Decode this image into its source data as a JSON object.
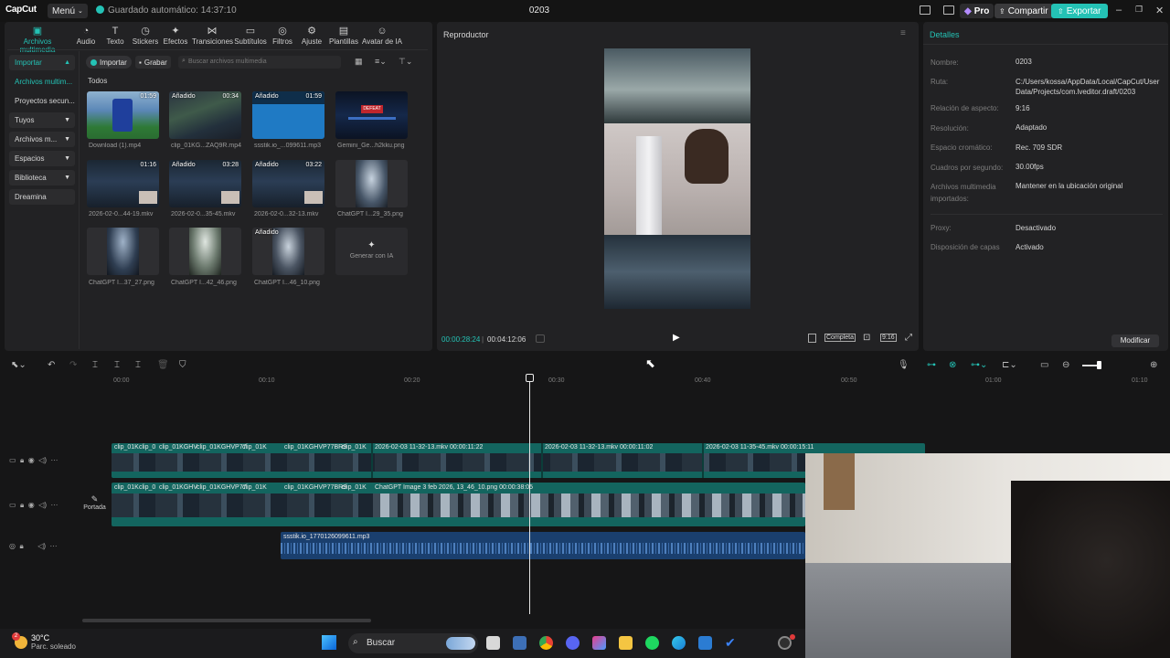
{
  "app": {
    "logo": "CapCut",
    "menu_label": "Menú",
    "autosave": "Guardado automático: 14:37:10",
    "project_title": "0203",
    "pro_label": "Pro",
    "share_label": "Compartir",
    "export_label": "Exportar",
    "accent_color": "#24c2b5"
  },
  "tools": [
    {
      "label": "Archivos multimedia",
      "icon": "media-icon"
    },
    {
      "label": "Audio",
      "icon": "audio-icon"
    },
    {
      "label": "Texto",
      "icon": "text-icon"
    },
    {
      "label": "Stickers",
      "icon": "sticker-icon"
    },
    {
      "label": "Efectos",
      "icon": "effects-icon"
    },
    {
      "label": "Transiciones",
      "icon": "transitions-icon"
    },
    {
      "label": "Subtítulos",
      "icon": "subtitles-icon"
    },
    {
      "label": "Filtros",
      "icon": "filters-icon"
    },
    {
      "label": "Ajuste",
      "icon": "adjust-icon"
    },
    {
      "label": "Plantillas",
      "icon": "templates-icon"
    },
    {
      "label": "Avatar de IA",
      "icon": "ai-avatar-icon"
    }
  ],
  "sidebar": {
    "items": [
      {
        "label": "Importar"
      },
      {
        "label": "Archivos multim..."
      },
      {
        "label": "Proyectos secun..."
      },
      {
        "label": "Tuyos"
      },
      {
        "label": "Archivos m..."
      },
      {
        "label": "Espacios"
      },
      {
        "label": "Biblioteca"
      },
      {
        "label": "Dreamina"
      }
    ]
  },
  "media": {
    "import_label": "Importar",
    "record_label": "Grabar",
    "search_placeholder": "Buscar archivos multimedia",
    "section_label": "Todos",
    "items": [
      {
        "name": "Download (1).mp4",
        "badge": "",
        "duration": "01:59"
      },
      {
        "name": "clip_01KG...ZAQ9R.mp4",
        "badge": "Añadido",
        "duration": "00:34"
      },
      {
        "name": "ssstik.io_...099611.mp3",
        "badge": "Añadido",
        "duration": "01:59"
      },
      {
        "name": "Gemini_Ge...h2kku.png",
        "badge": "",
        "duration": ""
      },
      {
        "name": "2026-02-0...44-19.mkv",
        "badge": "",
        "duration": "01:16"
      },
      {
        "name": "2026-02-0...35-45.mkv",
        "badge": "Añadido",
        "duration": "03:28"
      },
      {
        "name": "2026-02-0...32-13.mkv",
        "badge": "Añadido",
        "duration": "03:22"
      },
      {
        "name": "ChatGPT I...29_35.png",
        "badge": "",
        "duration": ""
      },
      {
        "name": "ChatGPT I...37_27.png",
        "badge": "",
        "duration": ""
      },
      {
        "name": "ChatGPT I...42_46.png",
        "badge": "",
        "duration": ""
      },
      {
        "name": "ChatGPT I...46_10.png",
        "badge": "Añadido",
        "duration": ""
      }
    ],
    "generate_label": "Generar con IA",
    "thumb_thumb_text": "DEFEAT"
  },
  "player": {
    "title": "Reproductor",
    "current_time": "00:00:28:24",
    "total_time": "00:04:12:06",
    "full_label": "Completa",
    "ratio_label": "9:16"
  },
  "details": {
    "title": "Detalles",
    "rows": [
      {
        "label": "Nombre:",
        "value": "0203"
      },
      {
        "label": "Ruta:",
        "value": "C:/Users/kossa/AppData/Local/CapCut/User Data/Projects/com.lveditor.draft/0203"
      },
      {
        "label": "Relación de aspecto:",
        "value": "9:16"
      },
      {
        "label": "Resolución:",
        "value": "Adaptado"
      },
      {
        "label": "Espacio cromático:",
        "value": "Rec. 709 SDR"
      },
      {
        "label": "Cuadros por segundo:",
        "value": "30.00fps"
      },
      {
        "label": "Archivos multimedia importados:",
        "value": "Mantener en la ubicación original"
      },
      {
        "label": "Proxy:",
        "value": "Desactivado"
      },
      {
        "label": "Disposición de capas",
        "value": "Activado"
      }
    ],
    "modify_label": "Modificar"
  },
  "timeline": {
    "ticks": [
      "00:00",
      "00:10",
      "00:20",
      "00:30",
      "00:40",
      "00:50",
      "01:00",
      "01:10"
    ],
    "track1_clips": [
      "clip_01K",
      "clip_0",
      "clip_01KGHV",
      "clip_01KGHVP77",
      "clip_01K",
      "clip_01KGHVP77BR9",
      "clip_01K",
      "2026-02-03 11-32-13.mkv  00:00:11:22",
      "2026-02-03 11-32-13.mkv  00:00:11:02",
      "2026-02-03 11-35-45.mkv  00:00:15:11"
    ],
    "track2_clips": [
      "clip_01K",
      "clip_0",
      "clip_01KGHV",
      "clip_01KGHVP77",
      "clip_01K",
      "clip_01KGHVP77BR9",
      "clip_01K",
      "ChatGPT Image 3 feb 2026, 13_46_10.png  00:00:38:05"
    ],
    "audio_clip": "ssstik.io_1770126099611.mp3",
    "cover_label": "Portada"
  },
  "taskbar": {
    "temperature": "30°C",
    "weather": "Parc. soleado",
    "search_label": "Buscar",
    "notification_count": "2"
  }
}
